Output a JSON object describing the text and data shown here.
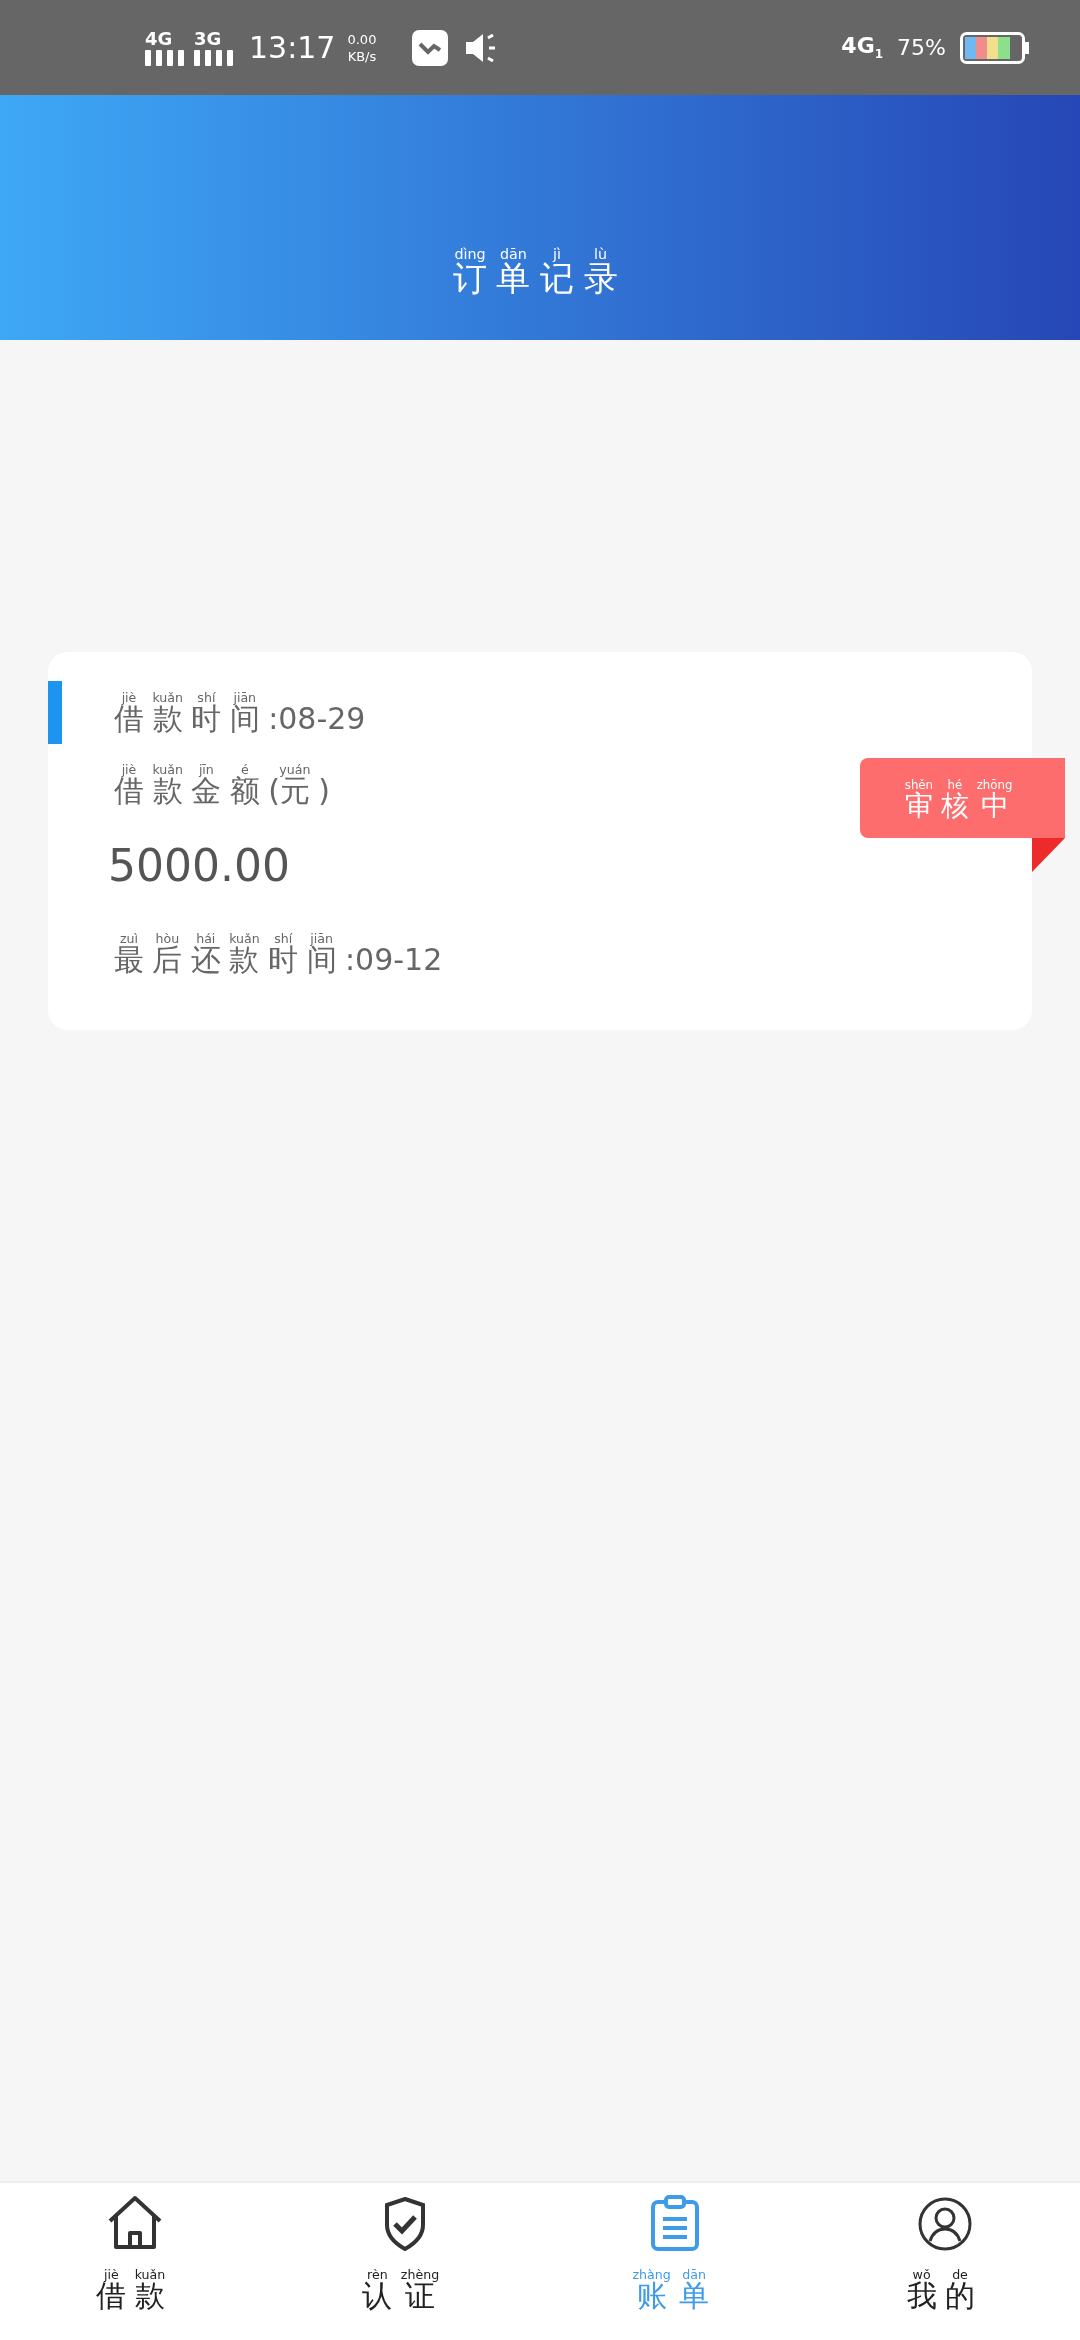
{
  "status_bar": {
    "sim1": "4G",
    "sim2": "3G",
    "time": "13:17",
    "speed": "0.00",
    "speed_unit": "KB/s",
    "network": "4G",
    "network_slot": "1",
    "battery": "75%"
  },
  "header": {
    "title": [
      {
        "hanzi": "订",
        "pinyin": "dìng"
      },
      {
        "hanzi": "单",
        "pinyin": "dān"
      },
      {
        "hanzi": "记",
        "pinyin": "jì"
      },
      {
        "hanzi": "录",
        "pinyin": "lù"
      }
    ]
  },
  "order": {
    "loan_date": [
      {
        "hanzi": "借",
        "pinyin": "jiè"
      },
      {
        "hanzi": "款",
        "pinyin": "kuǎn"
      },
      {
        "hanzi": "时",
        "pinyin": "shí"
      },
      {
        "hanzi": "间",
        "pinyin": "jiān"
      },
      {
        "text": ":08-29"
      }
    ],
    "amount_label": [
      {
        "hanzi": "借",
        "pinyin": "jiè"
      },
      {
        "hanzi": "款",
        "pinyin": "kuǎn"
      },
      {
        "hanzi": "金",
        "pinyin": "jīn"
      },
      {
        "hanzi": "额",
        "pinyin": "é"
      },
      {
        "text": "("
      },
      {
        "hanzi": "元",
        "pinyin": "yuán"
      },
      {
        "text": ")"
      }
    ],
    "amount": "5000.00",
    "due_date": [
      {
        "hanzi": "最",
        "pinyin": "zuì"
      },
      {
        "hanzi": "后",
        "pinyin": "hòu"
      },
      {
        "hanzi": "还",
        "pinyin": "hái"
      },
      {
        "hanzi": "款",
        "pinyin": "kuǎn"
      },
      {
        "hanzi": "时",
        "pinyin": "shí"
      },
      {
        "hanzi": "间",
        "pinyin": "jiān"
      },
      {
        "text": ":09-12"
      }
    ],
    "status": [
      {
        "hanzi": "审",
        "pinyin": "shěn"
      },
      {
        "hanzi": "核",
        "pinyin": "hé"
      },
      {
        "hanzi": "中",
        "pinyin": "zhōng"
      }
    ]
  },
  "tabs": [
    {
      "kind": "home",
      "selected": false,
      "label": [
        {
          "hanzi": "借",
          "pinyin": "jiè"
        },
        {
          "hanzi": "款",
          "pinyin": "kuǎn"
        }
      ]
    },
    {
      "kind": "verify",
      "selected": false,
      "label": [
        {
          "hanzi": "认",
          "pinyin": "rèn"
        },
        {
          "hanzi": "证",
          "pinyin": "zhèng"
        }
      ]
    },
    {
      "kind": "bill",
      "selected": true,
      "label": [
        {
          "hanzi": "账",
          "pinyin": "zhàng"
        },
        {
          "hanzi": "单",
          "pinyin": "dān"
        }
      ]
    },
    {
      "kind": "profile",
      "selected": false,
      "label": [
        {
          "hanzi": "我",
          "pinyin": "wǒ"
        },
        {
          "hanzi": "的",
          "pinyin": "de"
        }
      ]
    }
  ]
}
